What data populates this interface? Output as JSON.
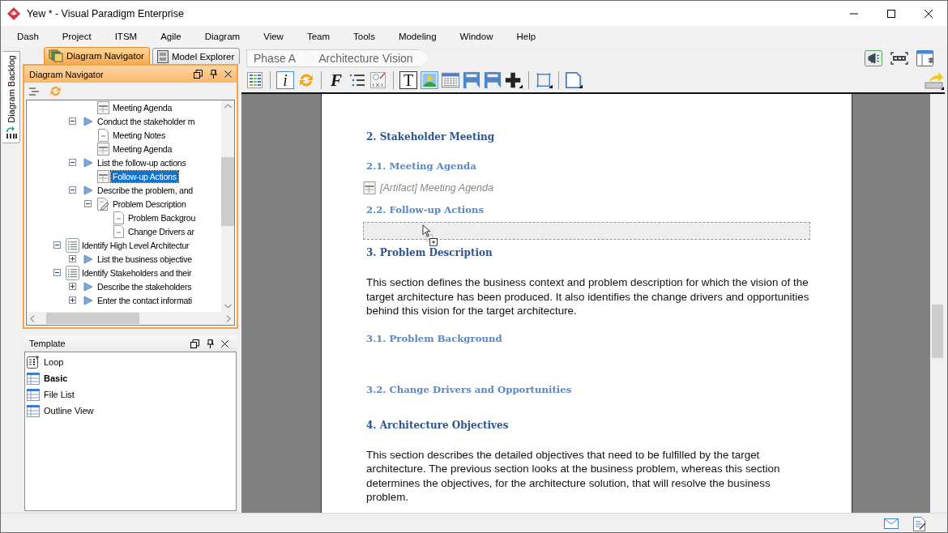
{
  "window": {
    "title": "Yew * - Visual Paradigm Enterprise"
  },
  "menu": [
    "Dash",
    "Project",
    "ITSM",
    "Agile",
    "Diagram",
    "View",
    "Team",
    "Tools",
    "Modeling",
    "Window",
    "Help"
  ],
  "side_tab": {
    "label": "Diagram Backlog"
  },
  "panel_tabs": [
    {
      "label": "Diagram Navigator",
      "selected": true
    },
    {
      "label": "Model Explorer",
      "selected": false
    }
  ],
  "navigator": {
    "title": "Diagram Navigator",
    "tree": [
      {
        "children": [
          {
            "children": [
              {
                "label": "Meeting Agenda",
                "kind": "artifact",
                "selected": false
              }
            ]
          },
          {
            "label": "Conduct the stakeholder m",
            "kind": "step",
            "expanded": true,
            "selected": false,
            "children": [
              {
                "label": "Meeting Notes",
                "kind": "note",
                "selected": false
              },
              {
                "label": "Meeting Agenda",
                "kind": "artifact",
                "selected": false
              }
            ]
          },
          {
            "label": "List the follow-up actions",
            "kind": "step",
            "expanded": true,
            "selected": false,
            "children": [
              {
                "label": "Follow-up Actions",
                "kind": "artifact",
                "selected": true
              }
            ]
          },
          {
            "label": "Describe the problem, and",
            "kind": "step",
            "expanded": true,
            "selected": false,
            "children": [
              {
                "label": "Problem Description",
                "kind": "doc",
                "expanded": true,
                "selected": false,
                "children": [
                  {
                    "label": "Problem Backgrou",
                    "kind": "note",
                    "selected": false
                  },
                  {
                    "label": "Change Drivers ar",
                    "kind": "note",
                    "selected": false
                  }
                ]
              }
            ]
          }
        ]
      },
      {
        "label": "Identify High Level Architectur",
        "kind": "list",
        "expanded": true,
        "selected": false,
        "children": [
          {
            "label": "List the business objective",
            "kind": "step",
            "expanded": false,
            "selected": false
          }
        ]
      },
      {
        "label": "Identify Stakeholders and their",
        "kind": "list",
        "expanded": true,
        "selected": false,
        "children": [
          {
            "label": "Describe the stakeholders",
            "kind": "step",
            "expanded": false,
            "selected": false
          },
          {
            "label": "Enter the contact informati",
            "kind": "step",
            "expanded": false,
            "selected": false
          }
        ]
      }
    ]
  },
  "template": {
    "title": "Template",
    "items": [
      {
        "label": "Loop",
        "kind": "loop",
        "default": false
      },
      {
        "label": "Basic",
        "kind": "table",
        "default": true
      },
      {
        "label": "File List",
        "kind": "table",
        "default": false
      },
      {
        "label": "Outline View",
        "kind": "table",
        "default": false
      }
    ]
  },
  "breadcrumb": [
    "Phase A",
    "Architecture Vision"
  ],
  "toolbar": [
    {
      "kind": "grid"
    },
    {
      "kind": "sep"
    },
    {
      "kind": "info",
      "glyph": "i"
    },
    {
      "kind": "refresh"
    },
    {
      "kind": "sep"
    },
    {
      "kind": "font",
      "glyph": "F"
    },
    {
      "kind": "list"
    },
    {
      "kind": "formula"
    },
    {
      "kind": "sep"
    },
    {
      "kind": "text",
      "glyph": "T"
    },
    {
      "kind": "image"
    },
    {
      "kind": "table"
    },
    {
      "kind": "break"
    },
    {
      "kind": "break"
    },
    {
      "kind": "plus"
    },
    {
      "kind": "sep"
    },
    {
      "kind": "frame"
    },
    {
      "kind": "sep"
    },
    {
      "kind": "page"
    }
  ],
  "document": {
    "blocks": [
      {
        "kind": "heading",
        "text": "2. Stakeholder Meeting"
      },
      {
        "kind": "subheading",
        "text": "2.1. Meeting Agenda"
      },
      {
        "kind": "artifact",
        "text": "[Artifact] Meeting Agenda"
      },
      {
        "kind": "subheading",
        "text": "2.2. Follow-up Actions"
      },
      {
        "kind": "dropzone"
      },
      {
        "kind": "heading",
        "text": "3. Problem Description"
      },
      {
        "kind": "paragraph",
        "text": "This section defines the business context and problem description for which the vision of the target architecture has been produced. It also identifies the change drivers and opportunities behind this vision for the target architecture."
      },
      {
        "kind": "subheading",
        "text": "3.1. Problem Background"
      },
      {
        "kind": "subheading",
        "text": "3.2. Change Drivers and Opportunities"
      },
      {
        "kind": "heading",
        "text": "4. Architecture Objectives"
      },
      {
        "kind": "paragraph",
        "text": "This section describes the detailed objectives that need to be fulfilled by the target architecture. The previous section looks at the business problem, whereas this section determines the objectives, for the architecture solution, that will resolve the business problem."
      }
    ]
  }
}
